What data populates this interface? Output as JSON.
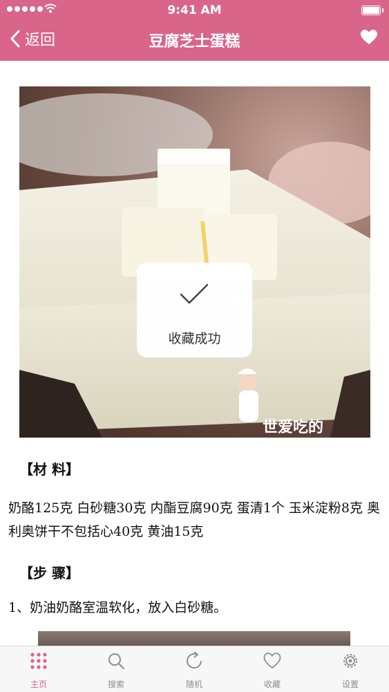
{
  "status_bar": {
    "time": "9:41 AM"
  },
  "nav": {
    "back_label": "返回",
    "title": "豆腐芝士蛋糕",
    "icons": {
      "back": "chevron-left-icon",
      "favorite": "heart-icon"
    }
  },
  "hero": {
    "watermark": "世爱吃的"
  },
  "toast": {
    "text": "收藏成功",
    "icon": "checkmark-icon"
  },
  "article": {
    "ingredients_heading": "【材 料】",
    "ingredients_text": "奶酪125克 白砂糖30克 内酯豆腐90克 蛋清1个 玉米淀粉8克 奥利奥饼干不包括心40克 黄油15克",
    "steps_heading": "【步 骤】",
    "step1": "1、奶油奶酪室温软化，放入白砂糖。"
  },
  "tabbar": {
    "active": "home",
    "tabs": [
      {
        "id": "home",
        "label": "主页",
        "icon": "grid-dots-icon"
      },
      {
        "id": "search",
        "label": "搜索",
        "icon": "search-icon"
      },
      {
        "id": "random",
        "label": "随机",
        "icon": "refresh-icon"
      },
      {
        "id": "favorites",
        "label": "收藏",
        "icon": "heart-outline-icon"
      },
      {
        "id": "settings",
        "label": "设置",
        "icon": "gear-icon"
      }
    ]
  },
  "colors": {
    "accent": "#d9658a",
    "tab_inactive": "#8e8e8e"
  }
}
